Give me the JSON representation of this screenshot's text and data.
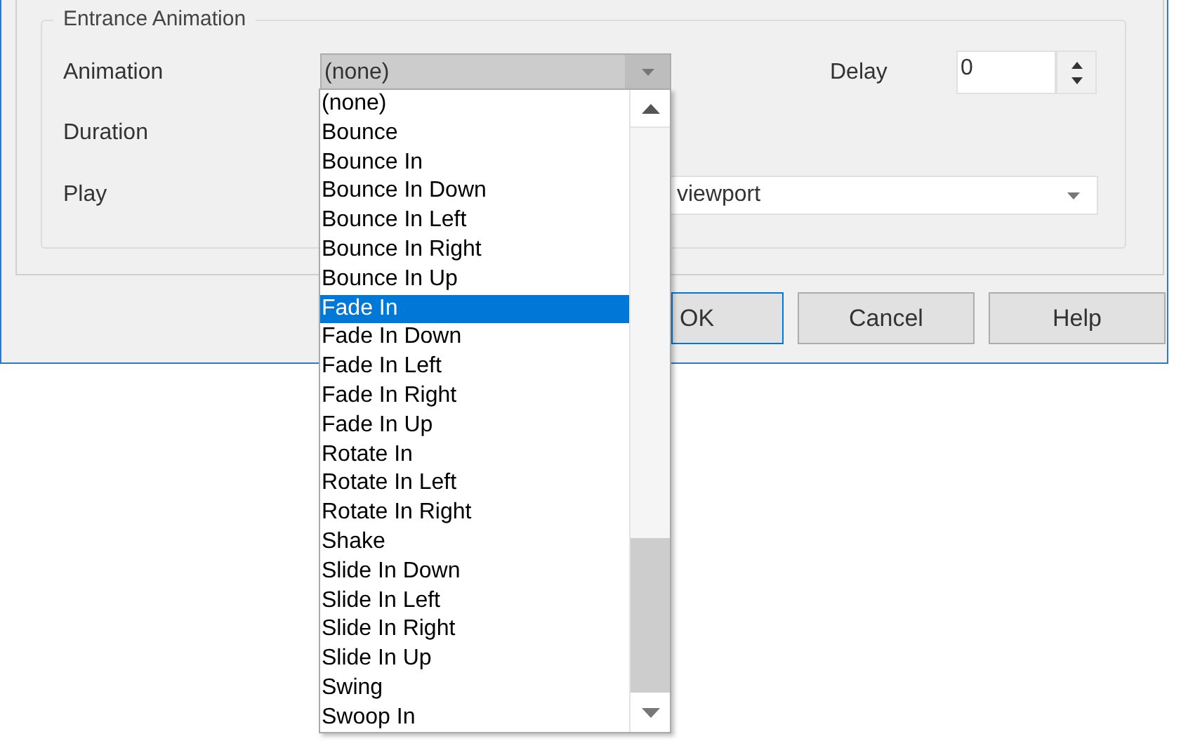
{
  "group": {
    "title": "Entrance Animation",
    "animation": {
      "label": "Animation",
      "value": "(none)",
      "expanded": true
    },
    "delay": {
      "label": "Delay",
      "value": "0"
    },
    "duration": {
      "label": "Duration"
    },
    "play": {
      "label": "Play",
      "value": "viewport"
    }
  },
  "buttons": [
    {
      "label": "OK",
      "default": true
    },
    {
      "label": "Cancel",
      "default": false
    },
    {
      "label": "Help",
      "default": false
    }
  ],
  "dropdown": {
    "items": [
      {
        "label": "(none)",
        "selected": false
      },
      {
        "label": "Bounce",
        "selected": false
      },
      {
        "label": "Bounce In",
        "selected": false
      },
      {
        "label": "Bounce In Down",
        "selected": false
      },
      {
        "label": "Bounce In Left",
        "selected": false
      },
      {
        "label": "Bounce In Right",
        "selected": false
      },
      {
        "label": "Bounce In Up",
        "selected": false
      },
      {
        "label": "Fade In",
        "selected": true
      },
      {
        "label": "Fade In Down",
        "selected": false
      },
      {
        "label": "Fade In Left",
        "selected": false
      },
      {
        "label": "Fade In Right",
        "selected": false
      },
      {
        "label": "Fade In Up",
        "selected": false
      },
      {
        "label": "Rotate In",
        "selected": false
      },
      {
        "label": "Rotate In Left",
        "selected": false
      },
      {
        "label": "Rotate In Right",
        "selected": false
      },
      {
        "label": "Shake",
        "selected": false
      },
      {
        "label": "Slide In Down",
        "selected": false
      },
      {
        "label": "Slide In Left",
        "selected": false
      },
      {
        "label": "Slide In Right",
        "selected": false
      },
      {
        "label": "Slide In Up",
        "selected": false
      },
      {
        "label": "Swing",
        "selected": false
      },
      {
        "label": "Swoop In",
        "selected": false
      }
    ]
  }
}
